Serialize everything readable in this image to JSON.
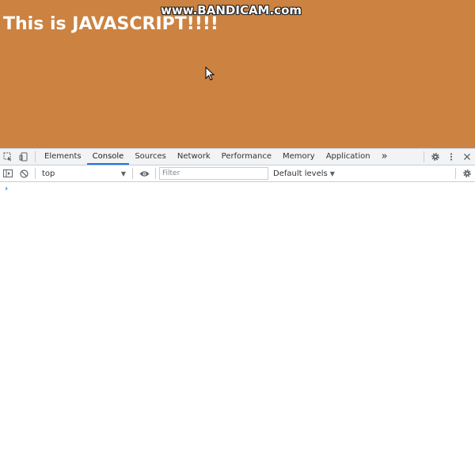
{
  "page": {
    "heading": "This is JAVASCRIPT!!!!",
    "watermark": "www.BANDICAM.com",
    "background_color": "#cc8240"
  },
  "devtools": {
    "left_icons": [
      "inspect-element-icon",
      "device-toolbar-icon"
    ],
    "tabs": [
      {
        "label": "Elements",
        "active": false
      },
      {
        "label": "Console",
        "active": true
      },
      {
        "label": "Sources",
        "active": false
      },
      {
        "label": "Network",
        "active": false
      },
      {
        "label": "Performance",
        "active": false
      },
      {
        "label": "Memory",
        "active": false
      },
      {
        "label": "Application",
        "active": false
      }
    ],
    "more_tabs_glyph": "»",
    "right_icons": [
      "settings-icon",
      "kebab-menu-icon",
      "close-icon"
    ],
    "console_toolbar": {
      "context": "top",
      "filter_placeholder": "Filter",
      "levels": "Default levels"
    },
    "prompt_glyph": "›",
    "accent_color": "#1a73e8"
  }
}
